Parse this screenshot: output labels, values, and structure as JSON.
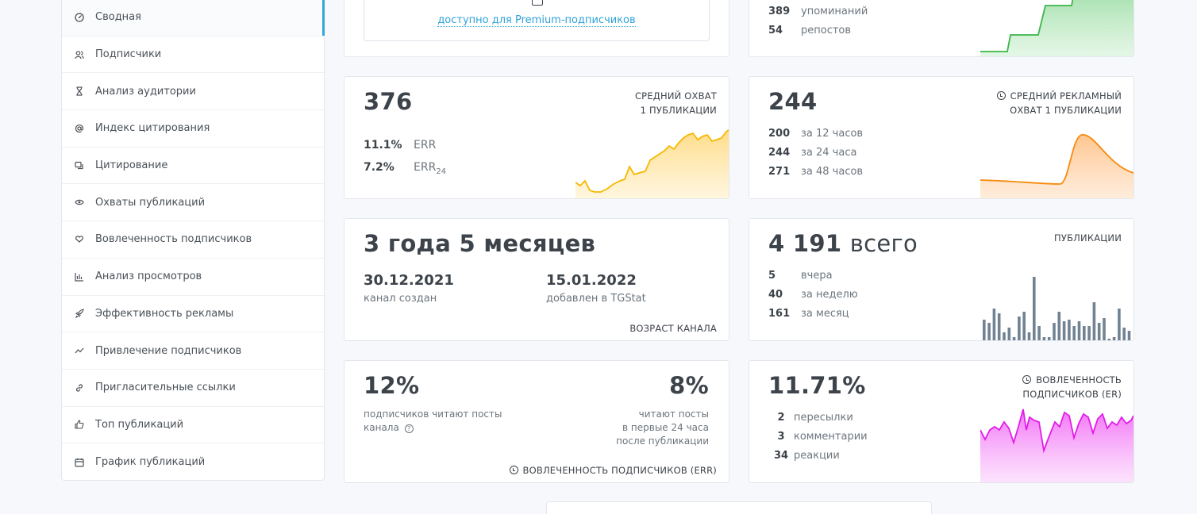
{
  "sidebar": {
    "items": [
      {
        "label": "Сводная",
        "icon": "dashboard-icon"
      },
      {
        "label": "Подписчики",
        "icon": "users-icon"
      },
      {
        "label": "Анализ аудитории",
        "icon": "hourglass-icon"
      },
      {
        "label": "Индекс цитирования",
        "icon": "at-icon"
      },
      {
        "label": "Цитирование",
        "icon": "quote-icon"
      },
      {
        "label": "Охваты публикаций",
        "icon": "eye-icon"
      },
      {
        "label": "Вовлеченность подписчиков",
        "icon": "heart-hand-icon"
      },
      {
        "label": "Анализ просмотров",
        "icon": "bar-chart-icon"
      },
      {
        "label": "Эффективность рекламы",
        "icon": "rocket-icon"
      },
      {
        "label": "Привлечение подписчиков",
        "icon": "trend-icon"
      },
      {
        "label": "Пригласительные ссылки",
        "icon": "link-icon"
      },
      {
        "label": "Топ публикаций",
        "icon": "thumbs-up-icon"
      },
      {
        "label": "График публикаций",
        "icon": "calendar-icon"
      }
    ]
  },
  "premium_card": {
    "link": "доступно для Premium-подписчиков"
  },
  "mentions_card": {
    "rows": [
      {
        "num": "389",
        "label": "упоминаний"
      },
      {
        "num": "54",
        "label": "репостов"
      }
    ]
  },
  "reach_card": {
    "value": "376",
    "caption_line1": "СРЕДНИЙ ОХВАТ",
    "caption_line2": "1 ПУБЛИКАЦИИ",
    "rows": [
      {
        "num": "11.1%",
        "label": "ERR"
      },
      {
        "num": "7.2%",
        "label": "ERR",
        "sub": "24"
      }
    ]
  },
  "ad_reach_card": {
    "value": "244",
    "caption_line1": "СРЕДНИЙ РЕКЛАМНЫЙ",
    "caption_line2": "ОХВАТ 1 ПУБЛИКАЦИИ",
    "rows": [
      {
        "num": "200",
        "label": "за 12 часов"
      },
      {
        "num": "244",
        "label": "за 24 часа"
      },
      {
        "num": "271",
        "label": "за 48 часов"
      }
    ]
  },
  "age_card": {
    "value": "3 года 5 месяцев",
    "created_date": "30.12.2021",
    "created_label": "канал создан",
    "added_date": "15.01.2022",
    "added_label": "добавлен в TGStat",
    "caption": "ВОЗРАСТ КАНАЛА"
  },
  "posts_card": {
    "value": "4 191",
    "value_suffix": "всего",
    "caption": "ПУБЛИКАЦИИ",
    "rows": [
      {
        "num": "5",
        "label": "вчера"
      },
      {
        "num": "40",
        "label": "за неделю"
      },
      {
        "num": "161",
        "label": "за месяц"
      }
    ]
  },
  "err_card": {
    "left_value": "12%",
    "left_text_line1": "подписчиков читают посты",
    "left_text_line2": "канала",
    "right_value": "8%",
    "right_text_line1": "читают посты",
    "right_text_line2": "в первые 24 часа",
    "right_text_line3": "после публикации",
    "caption": "ВОВЛЕЧЕННОСТЬ ПОДПИСЧИКОВ (ERR)"
  },
  "er_card": {
    "value": "11.71%",
    "caption_line1": "ВОВЛЕЧЕННОСТЬ",
    "caption_line2": "ПОДПИСЧИКОВ (ER)",
    "rows": [
      {
        "num": "2",
        "label": "пересылки"
      },
      {
        "num": "3",
        "label": "комментарии"
      },
      {
        "num": "34",
        "label": "реакции"
      }
    ]
  },
  "colors": {
    "accent": "#34a6d8",
    "green": "#3cb54a",
    "yellow": "#f5b800",
    "orange": "#f58a0e",
    "slate": "#718393",
    "magenta": "#ea1df0"
  }
}
